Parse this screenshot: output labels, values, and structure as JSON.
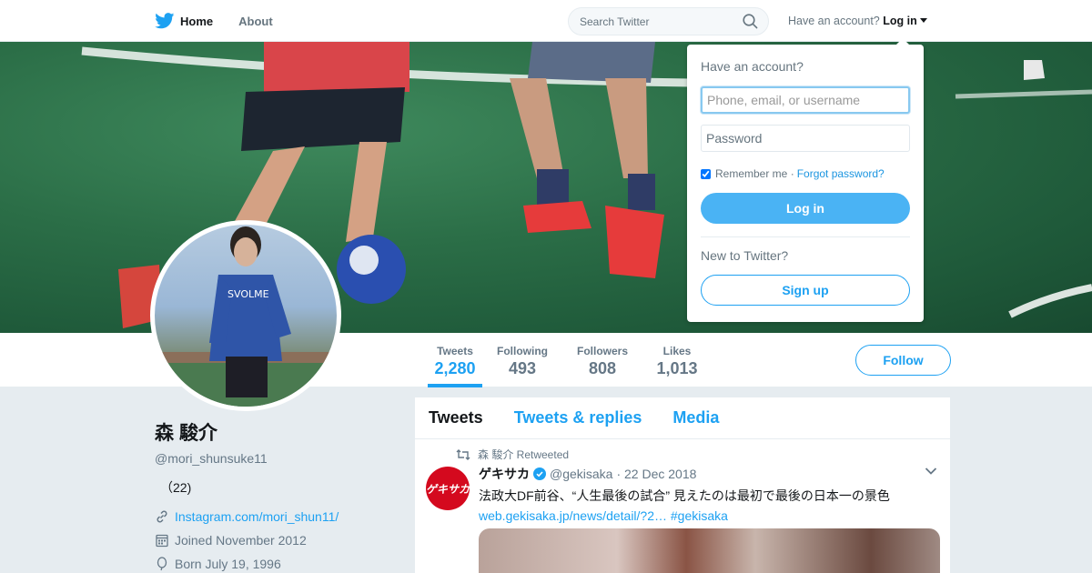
{
  "nav": {
    "home_label": "Home",
    "about_label": "About",
    "search_placeholder": "Search Twitter",
    "have_account_text": "Have an account?",
    "login_label": "Log in",
    "brand_icon": "twitter-bird-icon"
  },
  "profile": {
    "name": "森 駿介",
    "handle": "@mori_shunsuke11",
    "bio": "（22)",
    "website": "Instagram.com/mori_shun11/",
    "joined": "Joined November 2012",
    "born": "Born July 19, 1996",
    "follow_label": "Follow"
  },
  "stats": [
    {
      "label": "Tweets",
      "value": "2,280"
    },
    {
      "label": "Following",
      "value": "493"
    },
    {
      "label": "Followers",
      "value": "808"
    },
    {
      "label": "Likes",
      "value": "1,013"
    }
  ],
  "timeline": {
    "tabs": [
      "Tweets",
      "Tweets & replies",
      "Media"
    ],
    "tweet": {
      "retweeted_by": "森 駿介 Retweeted",
      "author_name": "ゲキサカ",
      "author_handle": "@gekisaka",
      "date": "· 22 Dec 2018",
      "text": "法政大DF前谷、“人生最後の試合” 見えたのは最初で最後の日本一の景色",
      "link": "web.gekisaka.jp/news/detail/?2… #gekisaka",
      "avatar_text": "ゲキサカ"
    }
  },
  "login_dropdown": {
    "title": "Have an account?",
    "username_placeholder": "Phone, email, or username",
    "password_placeholder": "Password",
    "remember_label": "Remember me ·",
    "forgot_label": "Forgot password?",
    "login_button": "Log in",
    "new_text": "New to Twitter?",
    "signup_button": "Sign up"
  },
  "colors": {
    "accent": "#1da1f2",
    "background": "#e6ecf0",
    "login_button": "#4ab3f4"
  }
}
